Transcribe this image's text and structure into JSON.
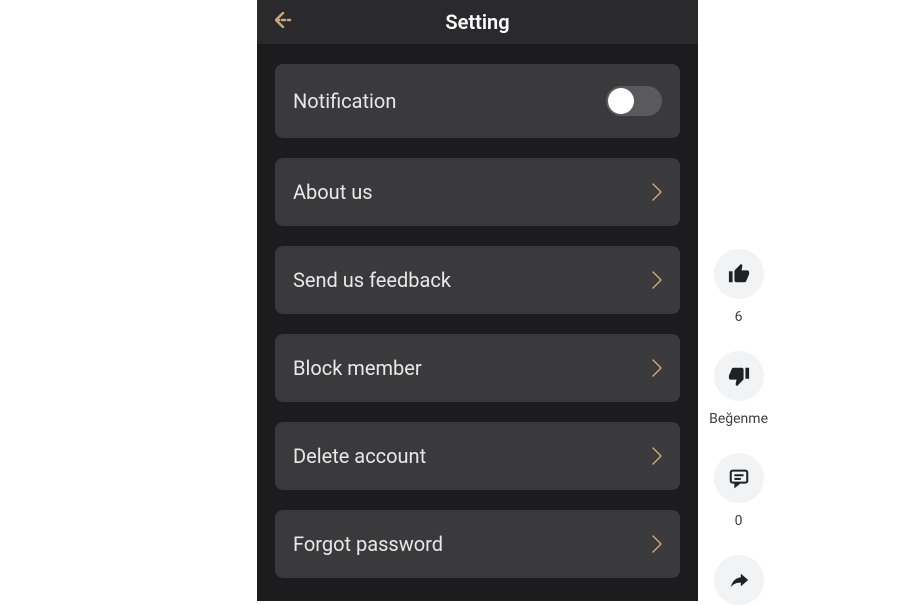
{
  "header": {
    "title": "Setting"
  },
  "settings": {
    "notification": {
      "label": "Notification",
      "toggled": false
    },
    "about_us": {
      "label": "About us"
    },
    "feedback": {
      "label": "Send us feedback"
    },
    "block_member": {
      "label": "Block member"
    },
    "delete_account": {
      "label": "Delete account"
    },
    "forgot_password": {
      "label": "Forgot password"
    }
  },
  "sidebar": {
    "like": {
      "count": "6"
    },
    "dislike": {
      "label": "Beğenme"
    },
    "comment": {
      "count": "0"
    }
  }
}
